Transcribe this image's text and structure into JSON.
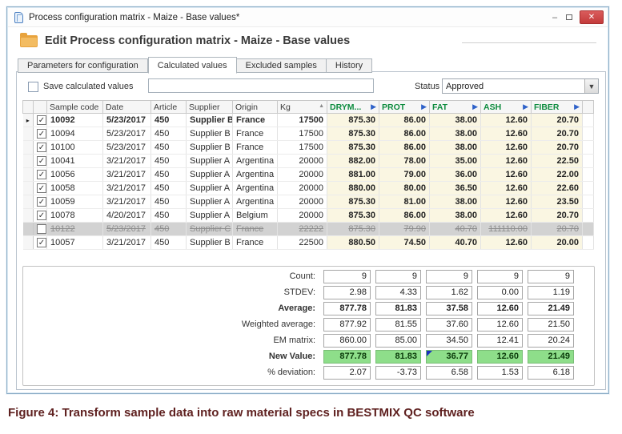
{
  "window": {
    "title": "Process configuration matrix - Maize - Base values*"
  },
  "icons": {
    "minimize_glyph": "–",
    "close_glyph": "✕",
    "check_glyph": "✓",
    "play_glyph": "▶",
    "sort_asc_glyph": "▲",
    "row_indicator_glyph": "▸",
    "dropdown_glyph": "▼"
  },
  "header": {
    "title": "Edit Process configuration matrix - Maize - Base values"
  },
  "tabs": [
    {
      "label": "Parameters for configuration",
      "active": false
    },
    {
      "label": "Calculated values",
      "active": true
    },
    {
      "label": "Excluded samples",
      "active": false
    },
    {
      "label": "History",
      "active": false
    }
  ],
  "toolbar": {
    "save_label": "Save calculated values",
    "save_checked": false,
    "input_value": "",
    "status_label": "Status",
    "status_value": "Approved"
  },
  "table": {
    "columns": [
      {
        "key": "indicator",
        "label": ""
      },
      {
        "key": "checkbox",
        "label": ""
      },
      {
        "key": "sample_code",
        "label": "Sample code"
      },
      {
        "key": "date",
        "label": "Date"
      },
      {
        "key": "article",
        "label": "Article"
      },
      {
        "key": "supplier",
        "label": "Supplier"
      },
      {
        "key": "origin",
        "label": "Origin"
      },
      {
        "key": "kg",
        "label": "Kg",
        "sort": "asc"
      },
      {
        "key": "drym",
        "label": "DRYM...",
        "nutrient": true
      },
      {
        "key": "prot",
        "label": "PROT",
        "nutrient": true
      },
      {
        "key": "fat",
        "label": "FAT",
        "nutrient": true
      },
      {
        "key": "ash",
        "label": "ASH",
        "nutrient": true
      },
      {
        "key": "fiber",
        "label": "FIBER",
        "nutrient": true
      },
      {
        "key": "spacer",
        "label": ""
      }
    ],
    "rows": [
      {
        "current": true,
        "checked": true,
        "excluded": false,
        "sample_code": "10092",
        "date": "5/23/2017",
        "article": "450",
        "supplier": "Supplier B",
        "origin": "France",
        "kg": "17500",
        "drym": "875.30",
        "prot": "86.00",
        "fat": "38.00",
        "ash": "12.60",
        "fiber": "20.70"
      },
      {
        "current": false,
        "checked": true,
        "excluded": false,
        "sample_code": "10094",
        "date": "5/23/2017",
        "article": "450",
        "supplier": "Supplier B",
        "origin": "France",
        "kg": "17500",
        "drym": "875.30",
        "prot": "86.00",
        "fat": "38.00",
        "ash": "12.60",
        "fiber": "20.70"
      },
      {
        "current": false,
        "checked": true,
        "excluded": false,
        "sample_code": "10100",
        "date": "5/23/2017",
        "article": "450",
        "supplier": "Supplier B",
        "origin": "France",
        "kg": "17500",
        "drym": "875.30",
        "prot": "86.00",
        "fat": "38.00",
        "ash": "12.60",
        "fiber": "20.70"
      },
      {
        "current": false,
        "checked": true,
        "excluded": false,
        "sample_code": "10041",
        "date": "3/21/2017",
        "article": "450",
        "supplier": "Supplier A",
        "origin": "Argentina",
        "kg": "20000",
        "drym": "882.00",
        "prot": "78.00",
        "fat": "35.00",
        "ash": "12.60",
        "fiber": "22.50"
      },
      {
        "current": false,
        "checked": true,
        "excluded": false,
        "sample_code": "10056",
        "date": "3/21/2017",
        "article": "450",
        "supplier": "Supplier A",
        "origin": "Argentina",
        "kg": "20000",
        "drym": "881.00",
        "prot": "79.00",
        "fat": "36.00",
        "ash": "12.60",
        "fiber": "22.00"
      },
      {
        "current": false,
        "checked": true,
        "excluded": false,
        "sample_code": "10058",
        "date": "3/21/2017",
        "article": "450",
        "supplier": "Supplier A",
        "origin": "Argentina",
        "kg": "20000",
        "drym": "880.00",
        "prot": "80.00",
        "fat": "36.50",
        "ash": "12.60",
        "fiber": "22.60"
      },
      {
        "current": false,
        "checked": true,
        "excluded": false,
        "sample_code": "10059",
        "date": "3/21/2017",
        "article": "450",
        "supplier": "Supplier A",
        "origin": "Argentina",
        "kg": "20000",
        "drym": "875.30",
        "prot": "81.00",
        "fat": "38.00",
        "ash": "12.60",
        "fiber": "23.50"
      },
      {
        "current": false,
        "checked": true,
        "excluded": false,
        "sample_code": "10078",
        "date": "4/20/2017",
        "article": "450",
        "supplier": "Supplier A",
        "origin": "Belgium",
        "kg": "20000",
        "drym": "875.30",
        "prot": "86.00",
        "fat": "38.00",
        "ash": "12.60",
        "fiber": "20.70"
      },
      {
        "current": false,
        "checked": false,
        "excluded": true,
        "sample_code": "10122",
        "date": "5/23/2017",
        "article": "450",
        "supplier": "Supplier C",
        "origin": "France",
        "kg": "22222",
        "drym": "875.30",
        "prot": "79.90",
        "fat": "40.70",
        "ash": "111110.00",
        "fiber": "20.70"
      },
      {
        "current": false,
        "checked": true,
        "excluded": false,
        "sample_code": "10057",
        "date": "3/21/2017",
        "article": "450",
        "supplier": "Supplier B",
        "origin": "France",
        "kg": "22500",
        "drym": "880.50",
        "prot": "74.50",
        "fat": "40.70",
        "ash": "12.60",
        "fiber": "20.00"
      }
    ]
  },
  "summary": {
    "rows": [
      {
        "label": "Count:",
        "values": [
          "9",
          "9",
          "9",
          "9",
          "9"
        ],
        "bold": false,
        "green": false
      },
      {
        "label": "STDEV:",
        "values": [
          "2.98",
          "4.33",
          "1.62",
          "0.00",
          "1.19"
        ],
        "bold": false,
        "green": false
      },
      {
        "label": "Average:",
        "values": [
          "877.78",
          "81.83",
          "37.58",
          "12.60",
          "21.49"
        ],
        "bold": true,
        "green": false
      },
      {
        "label": "Weighted average:",
        "values": [
          "877.92",
          "81.55",
          "37.60",
          "12.60",
          "21.50"
        ],
        "bold": false,
        "green": false
      },
      {
        "label": "EM matrix:",
        "values": [
          "860.00",
          "85.00",
          "34.50",
          "12.41",
          "20.24"
        ],
        "bold": false,
        "green": false
      },
      {
        "label": "New Value:",
        "values": [
          "877.78",
          "81.83",
          "36.77",
          "12.60",
          "21.49"
        ],
        "bold": true,
        "green": true,
        "edited_cell_index": 2
      },
      {
        "label": "% deviation:",
        "values": [
          "2.07",
          "-3.73",
          "6.58",
          "1.53",
          "6.18"
        ],
        "bold": false,
        "green": false
      }
    ]
  },
  "caption": "Figure 4: Transform sample data into raw material specs in BESTMIX QC software",
  "colors": {
    "window_border": "#8fb0c9",
    "close_button": "#cf4b4b",
    "nutrient_header_green": "#0e8c3f",
    "nutrient_cell_cream": "#faf6e2",
    "new_value_green": "#8ede8a",
    "excluded_gray": "#d2d2d2",
    "caption_maroon": "#5f2120",
    "play_icon_blue": "#2f62c9",
    "edited_marker_blue": "#1b2fbf"
  }
}
